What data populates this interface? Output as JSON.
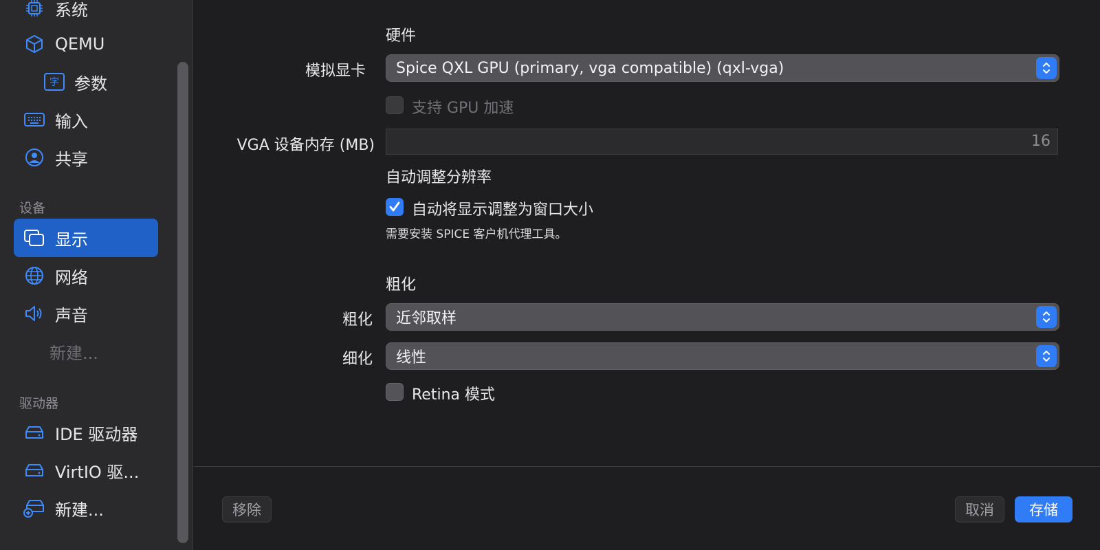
{
  "sidebar": {
    "items_top": [
      {
        "label": "系统",
        "icon": "chip-icon"
      },
      {
        "label": "QEMU",
        "icon": "cube-icon"
      },
      {
        "label": "参数",
        "icon": "text-argument-icon",
        "icon_glyph": "字"
      },
      {
        "label": "输入",
        "icon": "keyboard-icon"
      },
      {
        "label": "共享",
        "icon": "person-circle-icon"
      }
    ],
    "section_devices": "设备",
    "devices": [
      {
        "label": "显示",
        "icon": "display-icon",
        "active": true
      },
      {
        "label": "网络",
        "icon": "globe-icon"
      },
      {
        "label": "声音",
        "icon": "speaker-icon"
      },
      {
        "label": "新建...",
        "disabled": true
      }
    ],
    "section_drives": "驱动器",
    "drives": [
      {
        "label": "IDE 驱动器",
        "icon": "drive-icon"
      },
      {
        "label": "VirtIO 驱...",
        "icon": "drive-icon"
      },
      {
        "label": "新建...",
        "icon": "drive-add-icon"
      }
    ]
  },
  "hardware": {
    "heading": "硬件",
    "gpu_label": "模拟显卡",
    "gpu_value": "Spice QXL GPU (primary, vga compatible) (qxl-vga)",
    "gpu_accel_label": "支持 GPU 加速",
    "gpu_accel_checked": false,
    "vga_mem_label": "VGA 设备内存 (MB)",
    "vga_mem_value": "16"
  },
  "resolution": {
    "heading": "自动调整分辨率",
    "auto_resize_label": "自动将显示调整为窗口大小",
    "auto_resize_checked": true,
    "note": "需要安装 SPICE 客户机代理工具。"
  },
  "scaling": {
    "heading": "粗化",
    "upscale_label": "粗化",
    "upscale_value": "近邻取样",
    "downscale_label": "细化",
    "downscale_value": "线性",
    "retina_label": "Retina 模式",
    "retina_checked": false
  },
  "footer": {
    "remove_label": "移除",
    "cancel_label": "取消",
    "save_label": "存储"
  },
  "colors": {
    "accent": "#2f7cf6",
    "sidebar_active": "#1f61c7"
  }
}
